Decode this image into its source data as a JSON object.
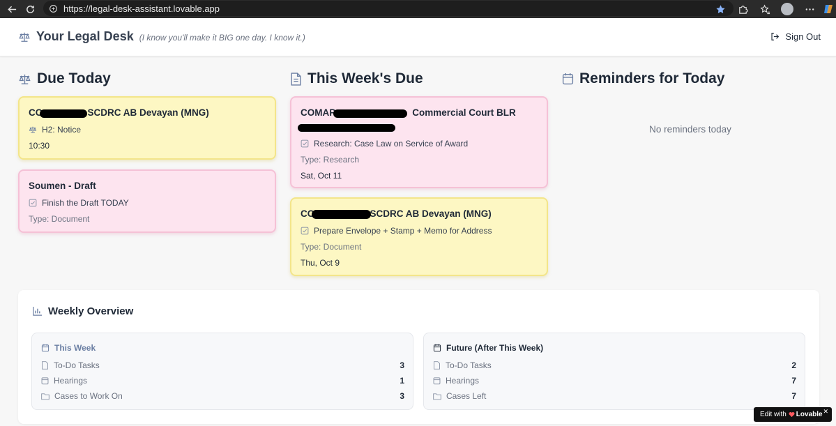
{
  "browser": {
    "url": "https://legal-desk-assistant.lovable.app"
  },
  "header": {
    "title": "Your Legal Desk",
    "tagline": "(I know you'll make it BIG one day. I know it.)",
    "sign_out": "Sign Out"
  },
  "columns": {
    "due_today": {
      "heading": "Due Today",
      "cards": [
        {
          "title": "CC",
          "title_rest": "SCDRC AB Devayan (MNG)",
          "line": "H2: Notice",
          "time": "10:30",
          "color": "#fdf7c3"
        },
        {
          "title": "Soumen - Draft",
          "line": "Finish the Draft TODAY",
          "type": "Type: Document",
          "color": "#fde4ef"
        }
      ]
    },
    "this_week": {
      "heading": "This Week's Due",
      "cards": [
        {
          "title": "COMAP",
          "title_rest": "Commercial Court BLR",
          "line": "Research: Case Law on Service of Award",
          "type": "Type: Research",
          "date": "Sat, Oct 11",
          "color": "#fde4ef"
        },
        {
          "title": "CC",
          "title_rest": "SCDRC AB Devayan (MNG)",
          "line": "Prepare Envelope + Stamp + Memo for Address",
          "type": "Type: Document",
          "date": "Thu, Oct 9",
          "color": "#fdf7c3"
        }
      ]
    },
    "reminders": {
      "heading": "Reminders for Today",
      "empty": "No reminders today"
    }
  },
  "overview": {
    "heading": "Weekly Overview",
    "this_week": {
      "title": "This Week",
      "rows": [
        {
          "label": "To-Do Tasks",
          "value": "3"
        },
        {
          "label": "Hearings",
          "value": "1"
        },
        {
          "label": "Cases to Work On",
          "value": "3"
        }
      ]
    },
    "future": {
      "title": "Future (After This Week)",
      "rows": [
        {
          "label": "To-Do Tasks",
          "value": "2"
        },
        {
          "label": "Hearings",
          "value": "7"
        },
        {
          "label": "Cases Left",
          "value": "7"
        }
      ]
    }
  },
  "badge": {
    "prefix": "Edit with",
    "brand": "Lovable"
  },
  "colors": {
    "accent": "#6b7fa3",
    "yellow_card": "#fdf7c3",
    "pink_card": "#fde4ef"
  }
}
